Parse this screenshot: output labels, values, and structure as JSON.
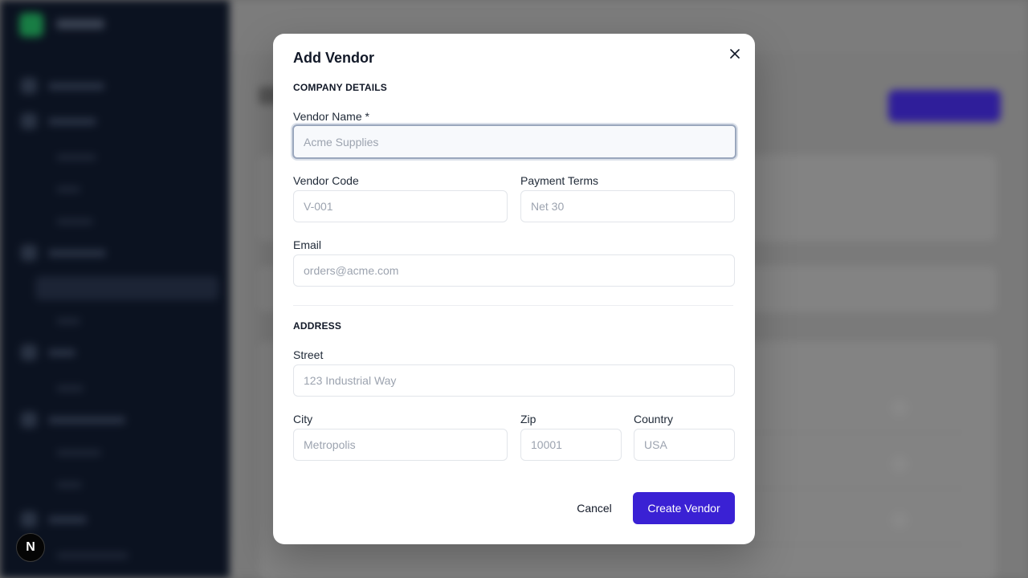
{
  "modal": {
    "title": "Add Vendor",
    "close_icon": "close-icon",
    "company_section": "COMPANY DETAILS",
    "address_section": "ADDRESS",
    "fields": {
      "vendor_name": {
        "label": "Vendor Name *",
        "placeholder": "Acme Supplies",
        "value": ""
      },
      "vendor_code": {
        "label": "Vendor Code",
        "placeholder": "V-001",
        "value": ""
      },
      "payment_terms": {
        "label": "Payment Terms",
        "placeholder": "Net 30",
        "value": ""
      },
      "email": {
        "label": "Email",
        "placeholder": "orders@acme.com",
        "value": ""
      },
      "street": {
        "label": "Street",
        "placeholder": "123 Industrial Way",
        "value": ""
      },
      "city": {
        "label": "City",
        "placeholder": "Metropolis",
        "value": ""
      },
      "zip": {
        "label": "Zip",
        "placeholder": "10001",
        "value": ""
      },
      "country": {
        "label": "Country",
        "placeholder": "USA",
        "value": ""
      }
    },
    "buttons": {
      "cancel": "Cancel",
      "create": "Create Vendor"
    }
  },
  "fab": {
    "label": "N"
  },
  "colors": {
    "primary": "#3a21d4",
    "sidebar": "#0b1220",
    "overlay": "#6f6f6f"
  }
}
